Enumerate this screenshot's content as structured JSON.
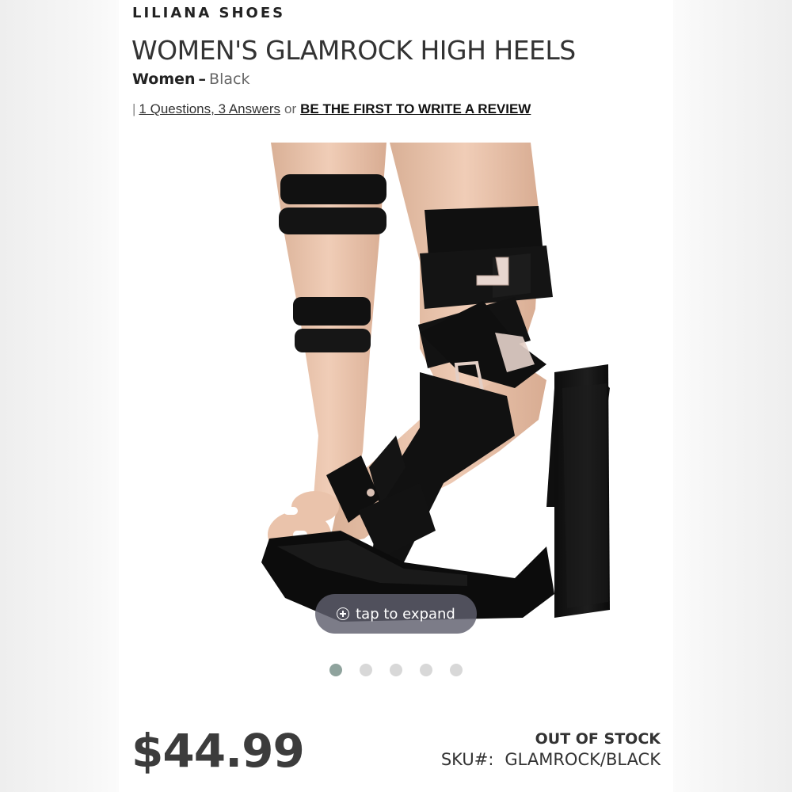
{
  "brand": "LILIANA SHOES",
  "product": {
    "title": "WOMEN'S GLAMROCK HIGH HEELS",
    "category": "Women",
    "separator": "–",
    "color": "Black"
  },
  "reviews": {
    "separator": "|",
    "questions_link": "1 Questions, 3 Answers",
    "or_text": "or",
    "write_review_link": "BE THE FIRST TO WRITE A REVIEW"
  },
  "gallery": {
    "image_icon": "product-photo-black-strappy-platform-heel",
    "expand_label": "tap to expand",
    "expand_icon": "plus-circle-icon",
    "slide_count": 5,
    "active_slide": 1,
    "active_dot_color": "#8fa39d",
    "inactive_dot_color": "#d8d8d8"
  },
  "pricing": {
    "price": "$44.99",
    "stock_status": "OUT OF STOCK",
    "sku_label": "SKU#:",
    "sku_value": "GLAMROCK/BLACK"
  }
}
